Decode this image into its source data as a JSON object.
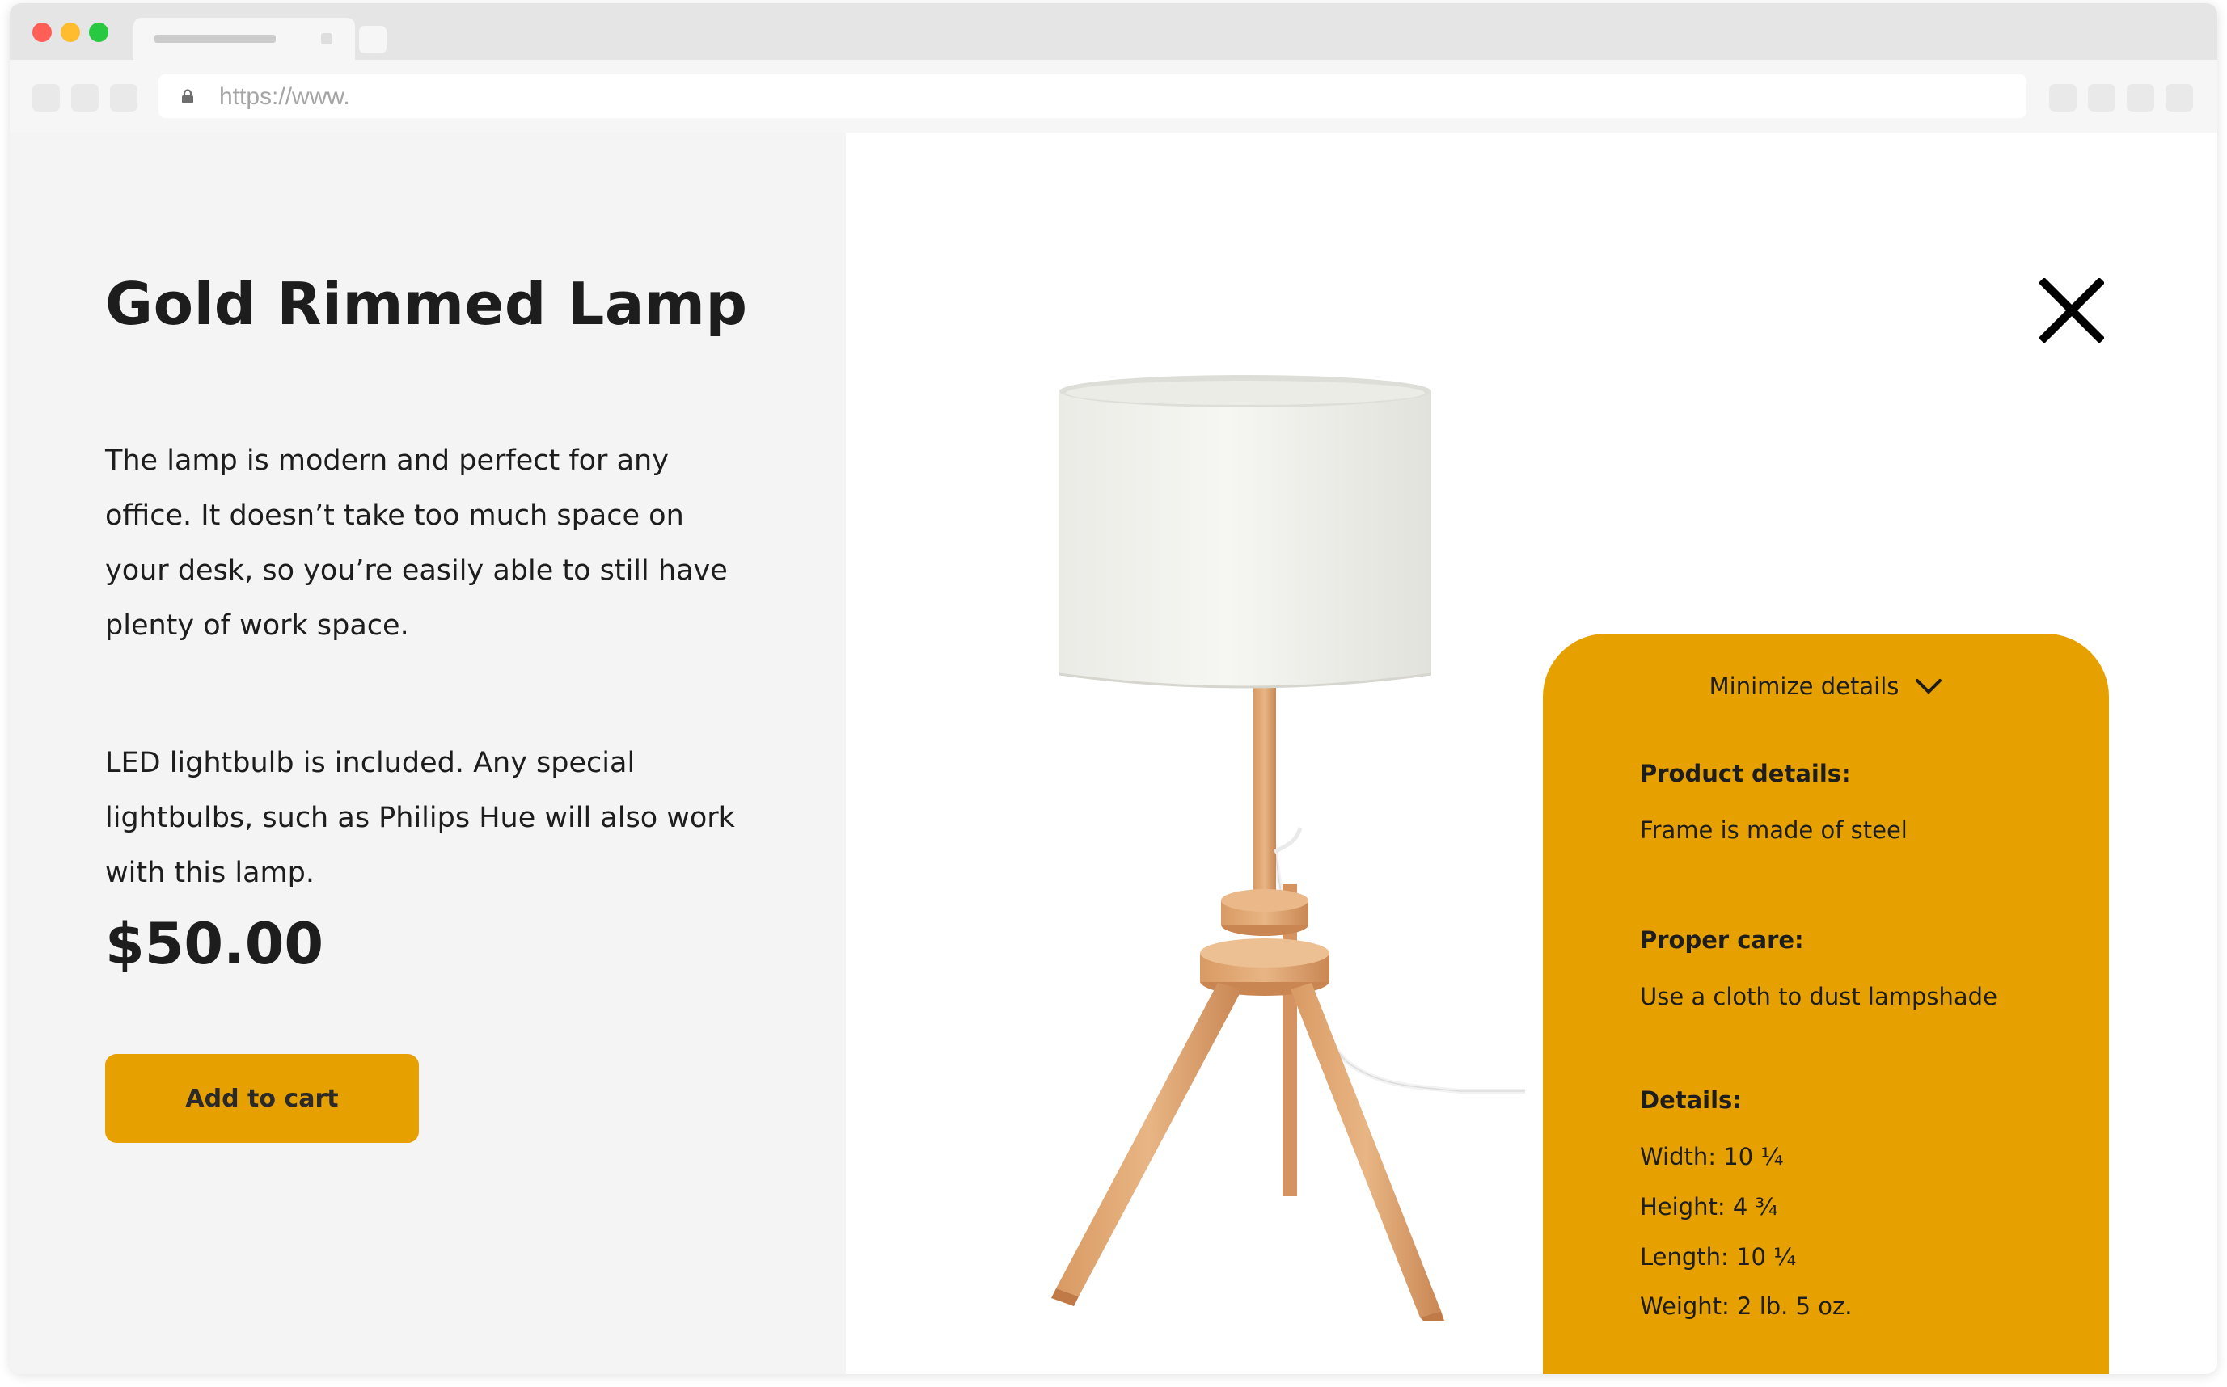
{
  "browser": {
    "url": "https://www."
  },
  "colors": {
    "accent": "#E6A100",
    "left_panel_bg": "#F4F4F4",
    "traffic_red": "#FF5F57",
    "traffic_yellow": "#FEBC2E",
    "traffic_green": "#28C840"
  },
  "product": {
    "title": "Gold Rimmed Lamp",
    "description_1": "The lamp is modern and perfect for any office. It doesn’t take too much space on your desk, so you’re easily able to still have plenty of work space.",
    "description_2": "LED lightbulb is included. Any special lightbulbs, such as Philips Hue will also work with this lamp.",
    "price": "$50.00",
    "add_to_cart_label": "Add to cart"
  },
  "details_card": {
    "toggle_label": "Minimize details",
    "product_details_heading": "Product details:",
    "product_details_text": "Frame is made of steel",
    "proper_care_heading": "Proper care:",
    "proper_care_text": "Use a cloth to dust lampshade",
    "details_heading": "Details:",
    "width": "Width: 10 ¼",
    "height": "Height: 4 ¾",
    "length": "Length: 10 ¼",
    "weight": "Weight: 2 lb. 5 oz."
  },
  "icons": {
    "close": "close-icon",
    "chevron": "chevron-down-icon",
    "lock": "lock-icon"
  }
}
